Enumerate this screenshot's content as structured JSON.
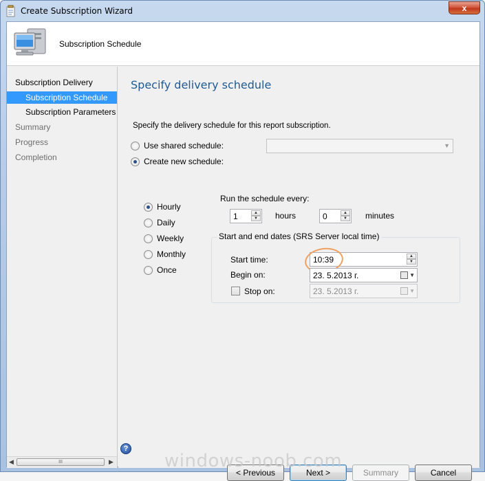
{
  "window": {
    "title": "Create Subscription Wizard",
    "close_glyph": "x"
  },
  "header": {
    "title": "Subscription Schedule",
    "icon": "computer-monitor-icon"
  },
  "nav": {
    "items": [
      {
        "label": "Subscription Delivery",
        "state": "normal"
      },
      {
        "label": "Subscription Schedule",
        "state": "selected"
      },
      {
        "label": "Subscription Parameters",
        "state": "normal"
      },
      {
        "label": "Summary",
        "state": "dim"
      },
      {
        "label": "Progress",
        "state": "dim"
      },
      {
        "label": "Completion",
        "state": "dim"
      }
    ],
    "scroll_thumb_grip": "III"
  },
  "main": {
    "heading": "Specify delivery schedule",
    "description": "Specify the delivery schedule for this report subscription.",
    "use_shared_label": "Use shared schedule:",
    "create_new_label": "Create new schedule:",
    "shared_combo_value": "",
    "frequency_options": [
      "Hourly",
      "Daily",
      "Weekly",
      "Monthly",
      "Once"
    ],
    "frequency_selected": "Hourly",
    "run_every_label": "Run the schedule every:",
    "hours_value": "1",
    "hours_label": "hours",
    "minutes_value": "0",
    "minutes_label": "minutes",
    "dates_group_title": "Start and end dates (SRS Server local time)",
    "start_time_label": "Start time:",
    "start_time_value": "10:39",
    "begin_on_label": "Begin on:",
    "begin_on_value": "23.  5.2013 г.",
    "stop_on_label": "Stop on:",
    "stop_on_value": "23.  5.2013 г.",
    "stop_on_checked": false
  },
  "footer": {
    "help_glyph": "?",
    "previous_label": "< Previous",
    "next_label": "Next >",
    "summary_label": "Summary",
    "cancel_label": "Cancel"
  },
  "watermark": "windows-noob.com",
  "colors": {
    "heading": "#1e5a94",
    "selection": "#3399ff",
    "highlight_ring": "#f0a060"
  }
}
